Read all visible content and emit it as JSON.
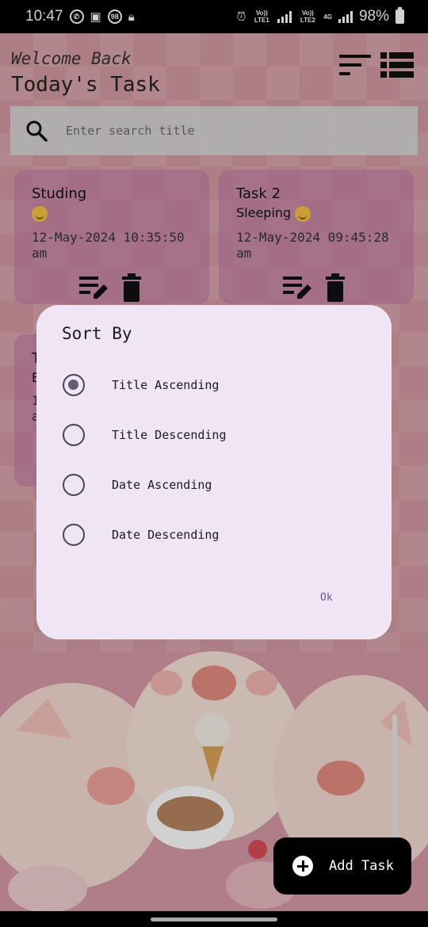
{
  "status_bar": {
    "time": "10:47",
    "notification_badge": "98",
    "sim1_label": "Vo)) LTE1",
    "sim2_label": "Vo)) LTE2",
    "network": "4G",
    "battery": "98%"
  },
  "header": {
    "welcome": "Welcome Back",
    "title": "Today's Task"
  },
  "search": {
    "placeholder": "Enter search title"
  },
  "tasks": [
    {
      "title": "Studing",
      "description": "",
      "date": "12-May-2024 10:35:50",
      "ampm": "am"
    },
    {
      "title": "Task 2",
      "description": "Sleeping",
      "date": "12-May-2024 09:45:28",
      "ampm": "am"
    },
    {
      "title": "T",
      "description": "E",
      "date": "1",
      "ampm": "a"
    }
  ],
  "sort_dialog": {
    "title": "Sort By",
    "options": [
      {
        "label": "Title Ascending",
        "selected": true
      },
      {
        "label": "Title Descending",
        "selected": false
      },
      {
        "label": "Date Ascending",
        "selected": false
      },
      {
        "label": "Date Descending",
        "selected": false
      }
    ],
    "ok_label": "Ok"
  },
  "fab": {
    "label": "Add Task"
  },
  "icons": {
    "sort": "sort-icon",
    "list_view": "list-view-icon",
    "search": "search-icon",
    "edit": "edit-note-icon",
    "delete": "delete-icon",
    "add": "add-circle-icon"
  },
  "colors": {
    "card_bg": "#be78a5",
    "dialog_bg": "#efe5f4",
    "radio_selected": "#625b71",
    "ok_text": "#65558f",
    "fab_bg": "#000000"
  }
}
